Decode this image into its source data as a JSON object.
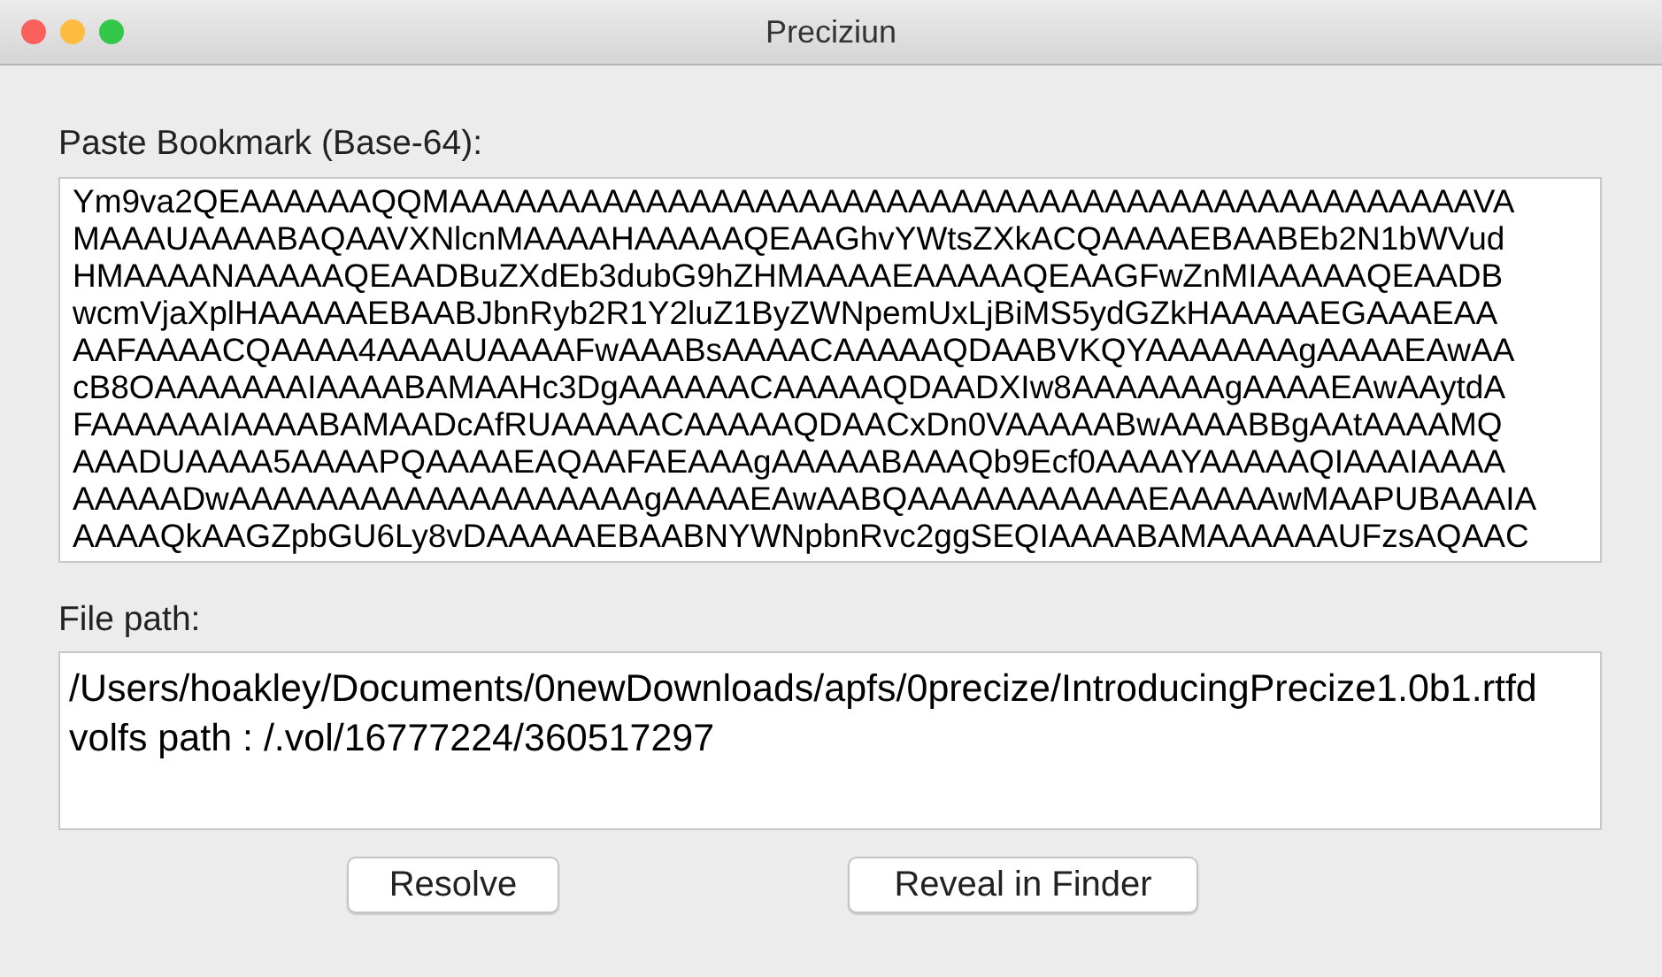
{
  "window": {
    "title": "Preciziun"
  },
  "bookmark": {
    "label": "Paste Bookmark (Base-64):",
    "lines": [
      "Ym9va2QEAAAAAAQQMAAAAAAAAAAAAAAAAAAAAAAAAAAAAAAAAAAAAAAAAAAAAAAAVA",
      "MAAAUAAAABAQAAVXNlcnMAAAAHAAAAAQEAAGhvYWtsZXkACQAAAAEBAABEb2N1bWVud",
      "HMAAAANAAAAAQEAADBuZXdEb3dubG9hZHMAAAAEAAAAAQEAAGFwZnMIAAAAAQEAADB",
      "wcmVjaXplHAAAAAEBAABJbnRyb2R1Y2luZ1ByZWNpemUxLjBiMS5ydGZkHAAAAAEGAAAEAA",
      "AAFAAAACQAAAA4AAAAUAAAAFwAAABsAAAACAAAAAQDAABVKQYAAAAAAAgAAAAEAwAA",
      "cB8OAAAAAAAIAAAABAMAAHc3DgAAAAAACAAAAAQDAADXIw8AAAAAAAgAAAAEAwAAytdA",
      "FAAAAAAIAAAABAMAADcAfRUAAAAACAAAAAQDAACxDn0VAAAAABwAAAABBgAAtAAAAMQ",
      "AAADUAAAA5AAAAPQAAAAEAQAAFAEAAAgAAAAABAAAQb9Ecf0AAAAYAAAAAQIAAAIAAAA",
      "AAAAADwAAAAAAAAAAAAAAAAAAAgAAAAEAwAABQAAAAAAAAAAAEAAAAAwMAAPUBAAAIA",
      "AAAAQkAAGZpbGU6Ly8vDAAAAAEBAABNYWNpbnRvc2ggSEQIAAAABAMAAAAAAUFzsAQAAC"
    ]
  },
  "file_path": {
    "label": "File path:",
    "lines": [
      "/Users/hoakley/Documents/0newDownloads/apfs/0precize/IntroducingPrecize1.0b1.rtfd",
      "volfs path : /.vol/16777224/360517297"
    ]
  },
  "buttons": [
    "Resolve",
    "Reveal in Finder"
  ]
}
